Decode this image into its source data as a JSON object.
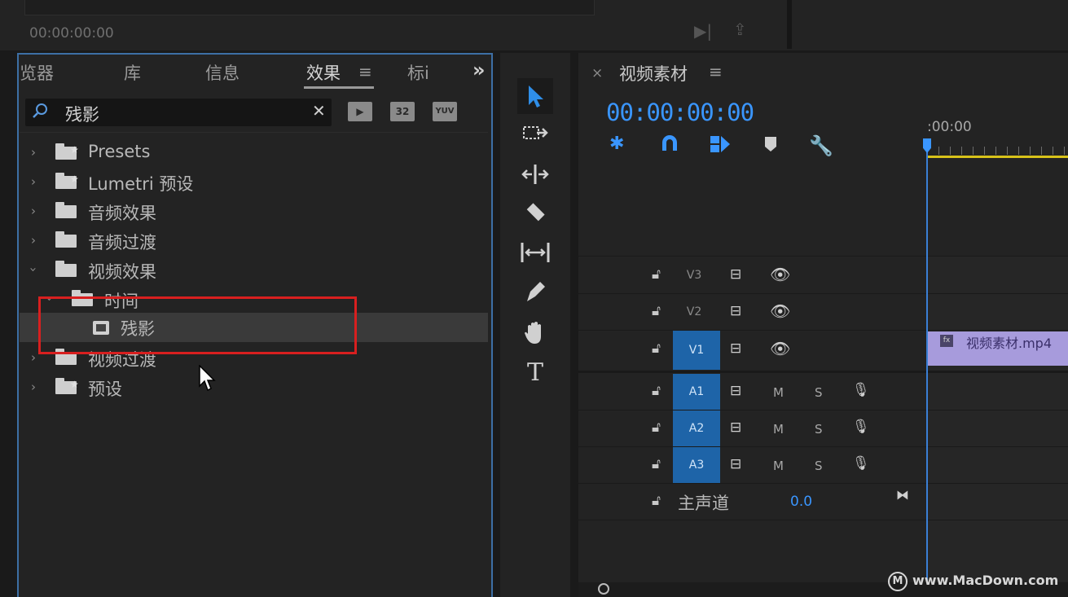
{
  "top": {
    "timecode": "00:00:00:00"
  },
  "effects_panel": {
    "tabs": [
      {
        "label": "浏览器",
        "display": "览器"
      },
      {
        "label": "库"
      },
      {
        "label": "信息"
      },
      {
        "label": "效果"
      },
      {
        "label": "标记",
        "display": "标i"
      }
    ],
    "more_label": "»",
    "menu_label": "≡",
    "search": {
      "value": "残影",
      "clear": "✕"
    },
    "badges": [
      "32",
      "YUV"
    ],
    "tree": [
      {
        "label": "Presets",
        "expanded": false,
        "preset": true
      },
      {
        "label": "Lumetri 预设",
        "expanded": false,
        "preset": true
      },
      {
        "label": "音频效果",
        "expanded": false
      },
      {
        "label": "音频过渡",
        "expanded": false
      },
      {
        "label": "视频效果",
        "expanded": true
      },
      {
        "label": "时间",
        "expanded": true,
        "level": 1
      },
      {
        "label": "残影",
        "level": 2,
        "selected": true,
        "effect": true
      },
      {
        "label": "视频过渡",
        "expanded": false
      },
      {
        "label": "预设",
        "expanded": false,
        "preset": true
      }
    ]
  },
  "tools": [
    "selection-tool",
    "track-select-tool",
    "ripple-edit-tool",
    "razor-tool",
    "slip-tool",
    "pen-tool",
    "hand-tool",
    "type-tool"
  ],
  "timeline": {
    "close": "×",
    "title": "视频素材",
    "menu": "≡",
    "timecode": "00:00:00:00",
    "ruler_start": ":00:00",
    "tracks": [
      {
        "name": "V3",
        "type": "video",
        "targeted": false
      },
      {
        "name": "V2",
        "type": "video",
        "targeted": false
      },
      {
        "name": "V1",
        "type": "video",
        "targeted": true
      },
      {
        "name": "A1",
        "type": "audio",
        "targeted": true
      },
      {
        "name": "A2",
        "type": "audio",
        "targeted": true
      },
      {
        "name": "A3",
        "type": "audio",
        "targeted": true
      }
    ],
    "mute": "M",
    "solo": "S",
    "master": {
      "label": "主声道",
      "value": "0.0"
    },
    "clip": {
      "label": "视频素材.mp4",
      "fx": "fx"
    }
  },
  "watermark": "www.MacDown.com",
  "colors": {
    "accent": "#3a96ff",
    "panel_border": "#3d6fa5",
    "highlight_box": "#d81f1f",
    "clip": "#a79bdc",
    "ruler_bar": "#d8c21a"
  }
}
